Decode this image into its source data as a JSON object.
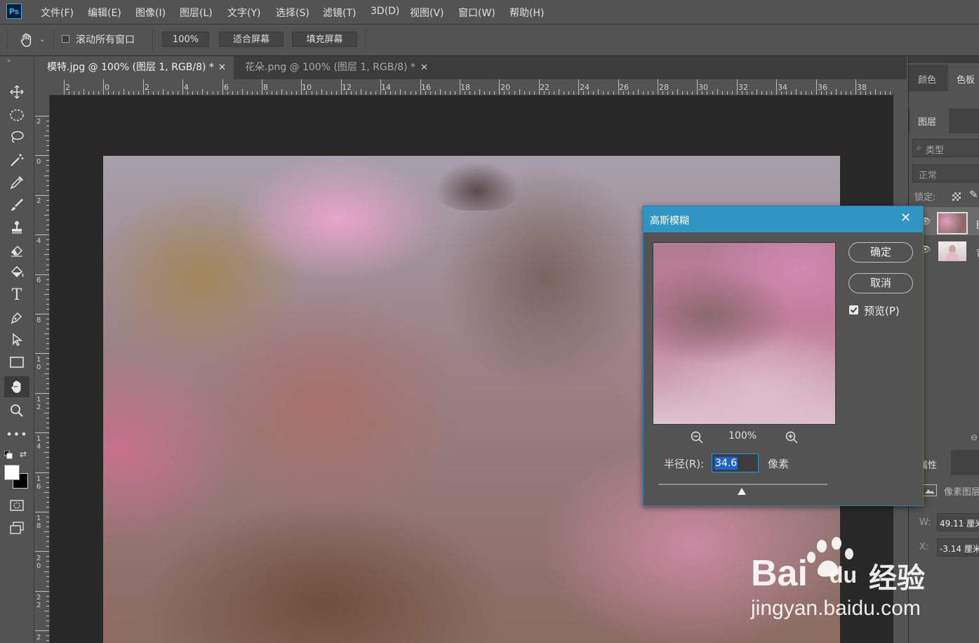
{
  "menubar": {
    "logo": "Ps",
    "items": [
      "文件(F)",
      "编辑(E)",
      "图像(I)",
      "图层(L)",
      "文字(Y)",
      "选择(S)",
      "滤镜(T)",
      "3D(D)",
      "视图(V)",
      "窗口(W)",
      "帮助(H)"
    ]
  },
  "options": {
    "scroll_all_label": "滚动所有窗口",
    "zoom_value": "100%",
    "fit_screen": "适合屏幕",
    "fill_screen": "填充屏幕"
  },
  "tabs": [
    {
      "label": "模特.jpg @ 100% (图层 1, RGB/8) *",
      "close": "✕",
      "active": true
    },
    {
      "label": "花朵.png @ 100% (图层 1, RGB/8) *",
      "close": "✕",
      "active": false
    }
  ],
  "ruler_h": [
    "2",
    "0",
    "2",
    "4",
    "6",
    "8",
    "10",
    "12",
    "14",
    "16",
    "18",
    "20",
    "22",
    "24",
    "26",
    "28",
    "30",
    "32",
    "34",
    "36",
    "38"
  ],
  "ruler_v": [
    "2",
    "0",
    "2",
    "4",
    "6",
    "8",
    "1\n0",
    "1\n2",
    "1\n4",
    "1\n6",
    "1\n8",
    "2\n0",
    "2\n2",
    "2"
  ],
  "right_panel": {
    "top_tabs": [
      "颜色",
      "色板"
    ],
    "layers_tab": "图层",
    "search_placeholder": "类型",
    "blend_mode": "正常",
    "lock_label": "锁定:",
    "layer1_letter": "图",
    "layer2_letter": "背",
    "properties_tab": "属性",
    "pixel_layer": "像素图层",
    "w_label": "W:",
    "w_value": "49.11 厘米",
    "x_label": "X:",
    "x_value": "-3.14 厘米"
  },
  "dialog": {
    "title": "高斯模糊",
    "ok": "确定",
    "cancel": "取消",
    "preview_label": "预览(P)",
    "preview_checked": true,
    "zoom_value": "100%",
    "radius_label": "半径(R):",
    "radius_value": "34.6",
    "radius_unit": "像素"
  },
  "watermark": {
    "brand_latin": "Bai",
    "brand_du": "du",
    "brand_cn": "经验",
    "url": "jingyan.baidu.com"
  },
  "colors": {
    "dialog_title_bg": "#3195c4",
    "selection_blue": "#1e64c8",
    "ps_blue": "#31a8ff"
  }
}
